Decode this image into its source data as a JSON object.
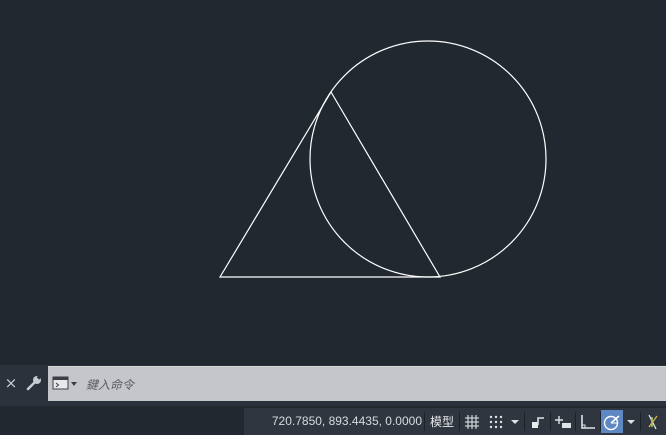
{
  "command_line": {
    "close_glyph": "×",
    "placeholder": "鍵入命令",
    "value": ""
  },
  "status_bar": {
    "coordinates": "720.7850, 893.4435, 0.0000",
    "model_label": "模型",
    "polar_active": true,
    "active_color": "#5e88c2"
  },
  "icons": {
    "close": "close-icon",
    "customize": "wrench-icon",
    "command_history": "command-prompt-icon",
    "grid": "grid-icon",
    "snap": "snap-mode-icon",
    "infer": "infer-constraints-icon",
    "dynamic_input": "dynamic-input-icon",
    "ortho": "ortho-mode-icon",
    "polar": "polar-tracking-icon",
    "isodraft": "isometric-drafting-icon"
  },
  "colors": {
    "canvas_background": "#212830",
    "geometry_stroke": "#ffffff",
    "command_field": "#c4c6c9"
  }
}
